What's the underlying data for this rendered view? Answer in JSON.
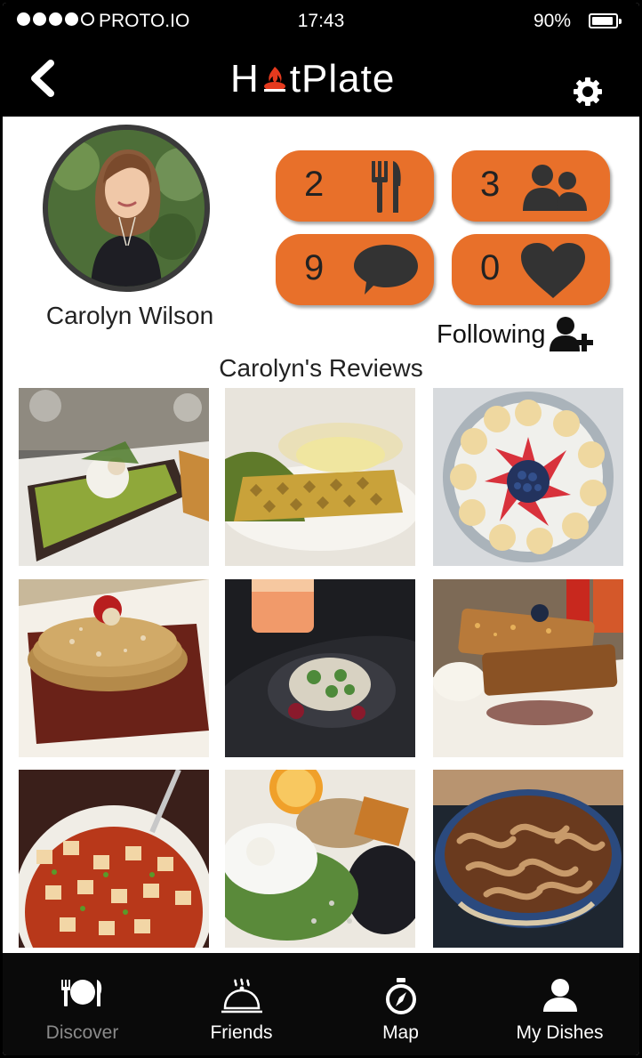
{
  "status_bar": {
    "carrier": "PROTO.IO",
    "time": "17:43",
    "battery_percent": "90%",
    "signal_bars": 4
  },
  "nav": {
    "logo_prefix": "H",
    "logo_suffix": "tPlate",
    "back_icon": "chevron-left-icon",
    "settings_icon": "gear-icon"
  },
  "profile": {
    "name": "Carolyn Wilson",
    "stats": {
      "dishes": "2",
      "friends": "3",
      "comments": "9",
      "likes": "0"
    },
    "following_label": "Following"
  },
  "reviews": {
    "title": "Carolyn's Reviews",
    "photo_count": 9
  },
  "tabs": [
    {
      "label": "Discover",
      "icon": "plate-icon",
      "active": false
    },
    {
      "label": "Friends",
      "icon": "cloche-icon",
      "active": true
    },
    {
      "label": "Map",
      "icon": "compass-icon",
      "active": true
    },
    {
      "label": "My Dishes",
      "icon": "user-icon",
      "active": true
    }
  ],
  "colors": {
    "accent": "#e8702a",
    "bar": "#000000",
    "flame": "#e53a1e"
  }
}
